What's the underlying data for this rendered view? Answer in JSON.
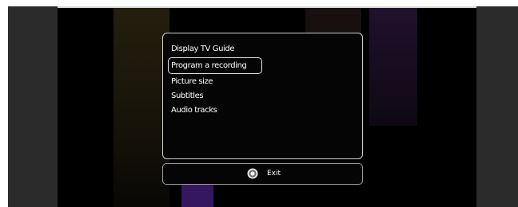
{
  "menu": {
    "items": [
      {
        "label": "Display TV Guide"
      },
      {
        "label": "Program a recording",
        "selected": true
      },
      {
        "label": "Picture size"
      },
      {
        "label": "Subtitles"
      },
      {
        "label": "Audio tracks"
      }
    ]
  },
  "exit_bar": {
    "icon": "remote-ok-button-icon",
    "label": "Exit"
  },
  "colors": {
    "panel_background": "#050505",
    "panel_border": "#cfcfcf",
    "selection_border": "#e6e6e6",
    "text": "#ffffff"
  }
}
